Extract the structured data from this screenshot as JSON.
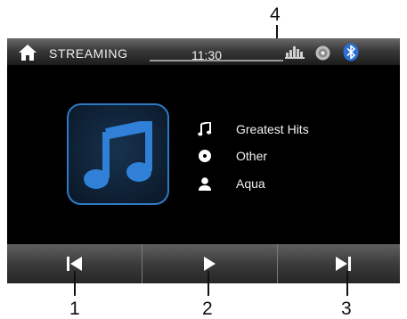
{
  "callouts": {
    "top": "4",
    "prev": "1",
    "play": "2",
    "next": "3"
  },
  "status_bar": {
    "source_label": "STREAMING",
    "time": "11:30",
    "icons": [
      "home-icon",
      "equalizer-icon",
      "disc-icon",
      "bluetooth-icon"
    ]
  },
  "track": {
    "title": "Greatest Hits",
    "album": "Other",
    "artist": "Aqua",
    "icons": [
      "music-note-icon",
      "disc-icon",
      "person-icon"
    ]
  },
  "controls": {
    "icons": [
      "previous-track-icon",
      "play-icon",
      "next-track-icon"
    ]
  },
  "colors": {
    "accent": "#2f78c4",
    "bluetooth": "#2a6fd6",
    "screen_background": "#000000",
    "bar_gradient_top": "#6a6a6a",
    "bar_gradient_bottom": "#1c1c1c"
  }
}
